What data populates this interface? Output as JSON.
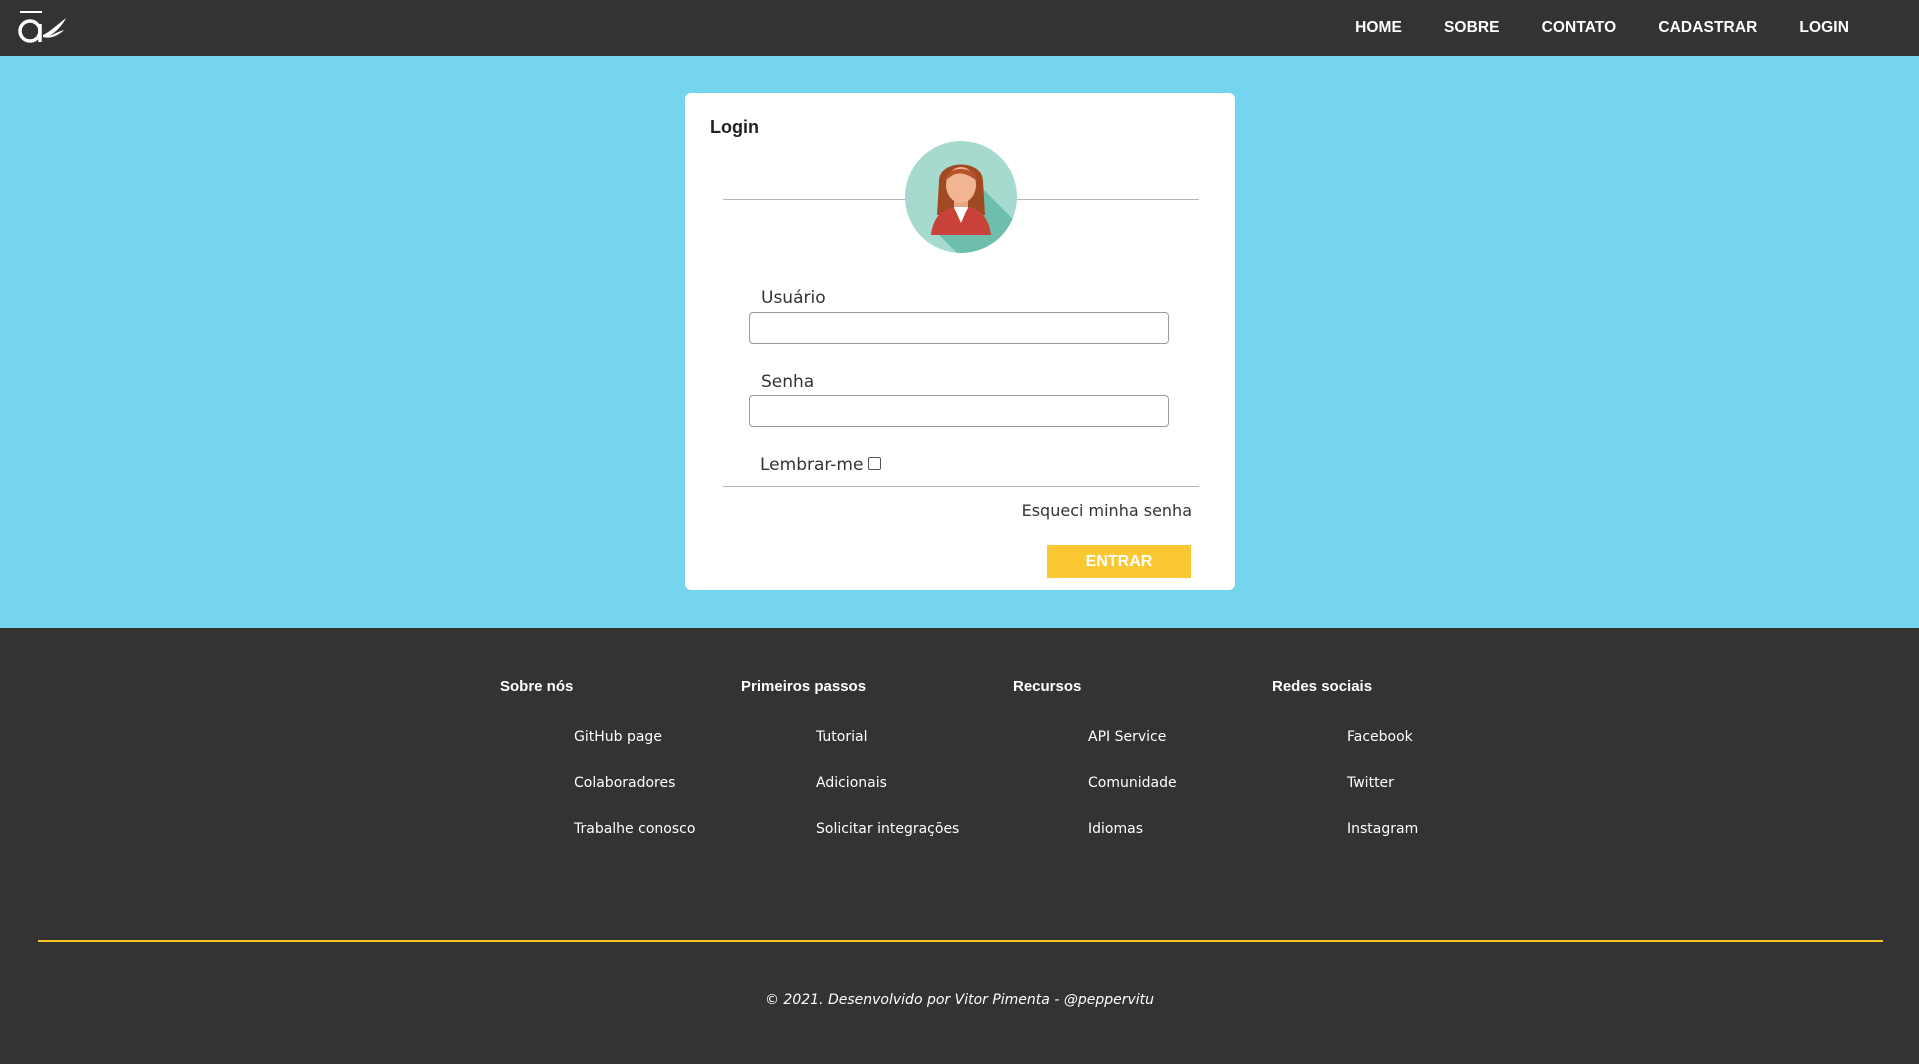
{
  "nav": {
    "logo": "app-logo",
    "links": [
      "HOME",
      "SOBRE",
      "CONTATO",
      "CADASTRAR",
      "LOGIN"
    ]
  },
  "login": {
    "title": "Login",
    "avatar": "user-avatar-icon",
    "username_label": "Usuário",
    "username_value": "",
    "password_label": "Senha",
    "password_value": "",
    "remember_label": "Lembrar-me",
    "remember_checked": false,
    "forgot_link": "Esqueci minha senha",
    "submit_label": "ENTRAR"
  },
  "footer": {
    "columns": [
      {
        "heading": "Sobre nós",
        "links": [
          "GitHub page",
          "Colaboradores",
          "Trabalhe conosco"
        ]
      },
      {
        "heading": "Primeiros passos",
        "links": [
          "Tutorial",
          "Adicionais",
          "Solicitar integrações"
        ]
      },
      {
        "heading": "Recursos",
        "links": [
          "API Service",
          "Comunidade",
          "Idiomas"
        ]
      },
      {
        "heading": "Redes sociais",
        "links": [
          "Facebook",
          "Twitter",
          "Instagram"
        ]
      }
    ],
    "copyright": "© 2021. Desenvolvido por Vitor Pimenta - @peppervitu"
  },
  "colors": {
    "background": "#75d5ee",
    "nav": "#333333",
    "accent": "#fbc832",
    "footer_line": "#f3c623"
  }
}
